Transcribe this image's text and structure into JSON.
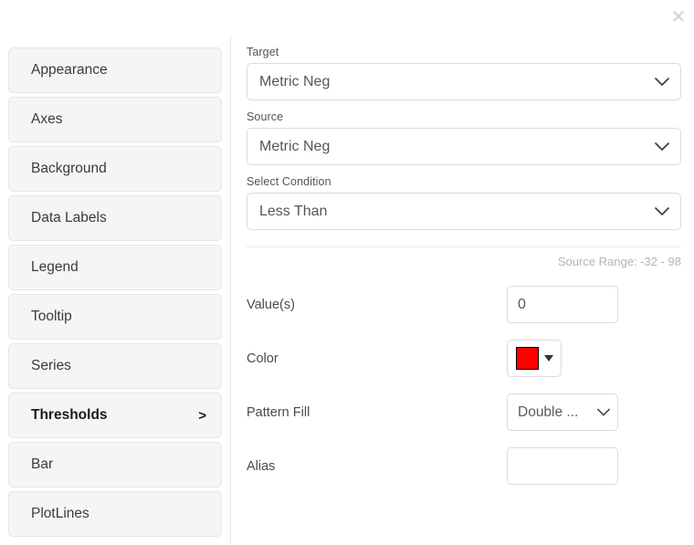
{
  "dialog": {
    "close_label": "✕"
  },
  "sidebar": {
    "items": [
      {
        "label": "Appearance",
        "active": false,
        "chevron": ""
      },
      {
        "label": "Axes",
        "active": false,
        "chevron": ""
      },
      {
        "label": "Background",
        "active": false,
        "chevron": ""
      },
      {
        "label": "Data Labels",
        "active": false,
        "chevron": ""
      },
      {
        "label": "Legend",
        "active": false,
        "chevron": ""
      },
      {
        "label": "Tooltip",
        "active": false,
        "chevron": ""
      },
      {
        "label": "Series",
        "active": false,
        "chevron": ""
      },
      {
        "label": "Thresholds",
        "active": true,
        "chevron": ">"
      },
      {
        "label": "Bar",
        "active": false,
        "chevron": ""
      },
      {
        "label": "PlotLines",
        "active": false,
        "chevron": ""
      }
    ]
  },
  "form": {
    "target": {
      "label": "Target",
      "value": "Metric Neg"
    },
    "source": {
      "label": "Source",
      "value": "Metric Neg"
    },
    "condition": {
      "label": "Select Condition",
      "value": "Less Than"
    },
    "source_range_note": "Source Range: -32 - 98",
    "values": {
      "label": "Value(s)",
      "value": "0",
      "placeholder": ""
    },
    "color": {
      "label": "Color",
      "value": "#FF0000"
    },
    "pattern_fill": {
      "label": "Pattern Fill",
      "value": "Double ..."
    },
    "alias": {
      "label": "Alias",
      "value": "",
      "placeholder": ""
    }
  }
}
